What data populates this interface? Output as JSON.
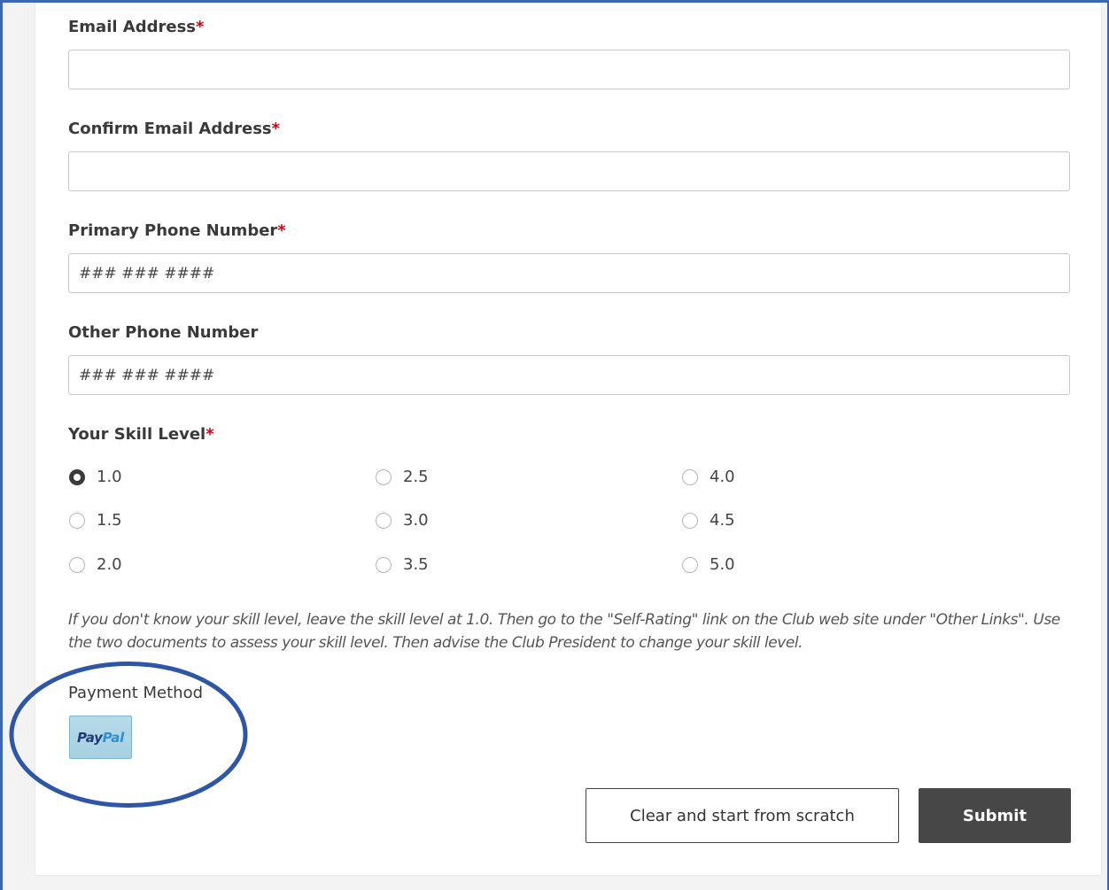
{
  "form": {
    "fields": [
      {
        "label": "Email Address",
        "required_mark": "*",
        "value": "",
        "placeholder": ""
      },
      {
        "label": "Confirm Email Address",
        "required_mark": "*",
        "value": "",
        "placeholder": ""
      },
      {
        "label": "Primary Phone Number",
        "required_mark": "*",
        "value": "",
        "placeholder": "### ### ####"
      },
      {
        "label": "Other Phone Number",
        "required_mark": "",
        "value": "",
        "placeholder": "### ### ####"
      }
    ],
    "skill_level": {
      "label": "Your Skill Level",
      "required_mark": "*",
      "selected": "1.0",
      "options": [
        "1.0",
        "1.5",
        "2.0",
        "2.5",
        "3.0",
        "3.5",
        "4.0",
        "4.5",
        "5.0"
      ],
      "help_text": "If you don't know your skill level, leave the skill level at 1.0. Then go to the \"Self-Rating\" link on the Club web site under \"Other Links\". Use the two documents to assess your skill level. Then advise the Club President to change your skill level."
    },
    "payment": {
      "label": "Payment Method",
      "paypal_pay": "Pay",
      "paypal_pal": "Pal"
    },
    "buttons": {
      "clear_label": "Clear and start from scratch",
      "submit_label": "Submit"
    }
  },
  "colors": {
    "frame_border": "#3b67b4",
    "required": "#d0021b",
    "submit_bg": "#474747",
    "highlight_ellipse": "#2f56a5"
  }
}
